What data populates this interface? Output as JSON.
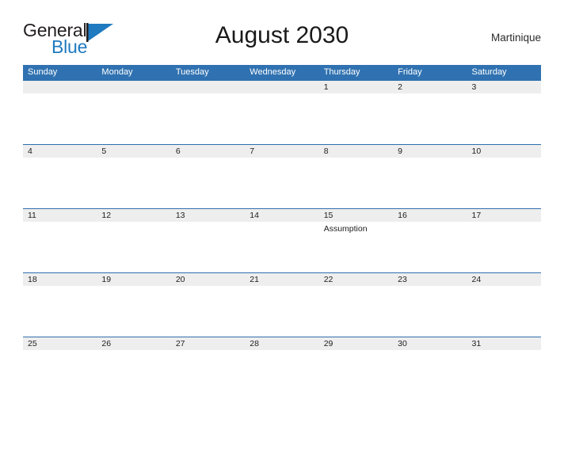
{
  "brand": {
    "name_part1": "General",
    "name_part2": "Blue",
    "flag_icon": "triangle-flag-icon",
    "color_dark": "#231f20",
    "color_blue": "#1f7ac0"
  },
  "header": {
    "title": "August 2030",
    "region": "Martinique"
  },
  "calendar": {
    "accent_color": "#3072b1",
    "band_color": "#eeeeee",
    "day_names": [
      "Sunday",
      "Monday",
      "Tuesday",
      "Wednesday",
      "Thursday",
      "Friday",
      "Saturday"
    ],
    "weeks": [
      {
        "days": [
          {
            "num": "",
            "events": []
          },
          {
            "num": "",
            "events": []
          },
          {
            "num": "",
            "events": []
          },
          {
            "num": "",
            "events": []
          },
          {
            "num": "1",
            "events": []
          },
          {
            "num": "2",
            "events": []
          },
          {
            "num": "3",
            "events": []
          }
        ]
      },
      {
        "days": [
          {
            "num": "4",
            "events": []
          },
          {
            "num": "5",
            "events": []
          },
          {
            "num": "6",
            "events": []
          },
          {
            "num": "7",
            "events": []
          },
          {
            "num": "8",
            "events": []
          },
          {
            "num": "9",
            "events": []
          },
          {
            "num": "10",
            "events": []
          }
        ]
      },
      {
        "days": [
          {
            "num": "11",
            "events": []
          },
          {
            "num": "12",
            "events": []
          },
          {
            "num": "13",
            "events": []
          },
          {
            "num": "14",
            "events": []
          },
          {
            "num": "15",
            "events": [
              "Assumption"
            ]
          },
          {
            "num": "16",
            "events": []
          },
          {
            "num": "17",
            "events": []
          }
        ]
      },
      {
        "days": [
          {
            "num": "18",
            "events": []
          },
          {
            "num": "19",
            "events": []
          },
          {
            "num": "20",
            "events": []
          },
          {
            "num": "21",
            "events": []
          },
          {
            "num": "22",
            "events": []
          },
          {
            "num": "23",
            "events": []
          },
          {
            "num": "24",
            "events": []
          }
        ]
      },
      {
        "days": [
          {
            "num": "25",
            "events": []
          },
          {
            "num": "26",
            "events": []
          },
          {
            "num": "27",
            "events": []
          },
          {
            "num": "28",
            "events": []
          },
          {
            "num": "29",
            "events": []
          },
          {
            "num": "30",
            "events": []
          },
          {
            "num": "31",
            "events": []
          }
        ]
      }
    ]
  }
}
